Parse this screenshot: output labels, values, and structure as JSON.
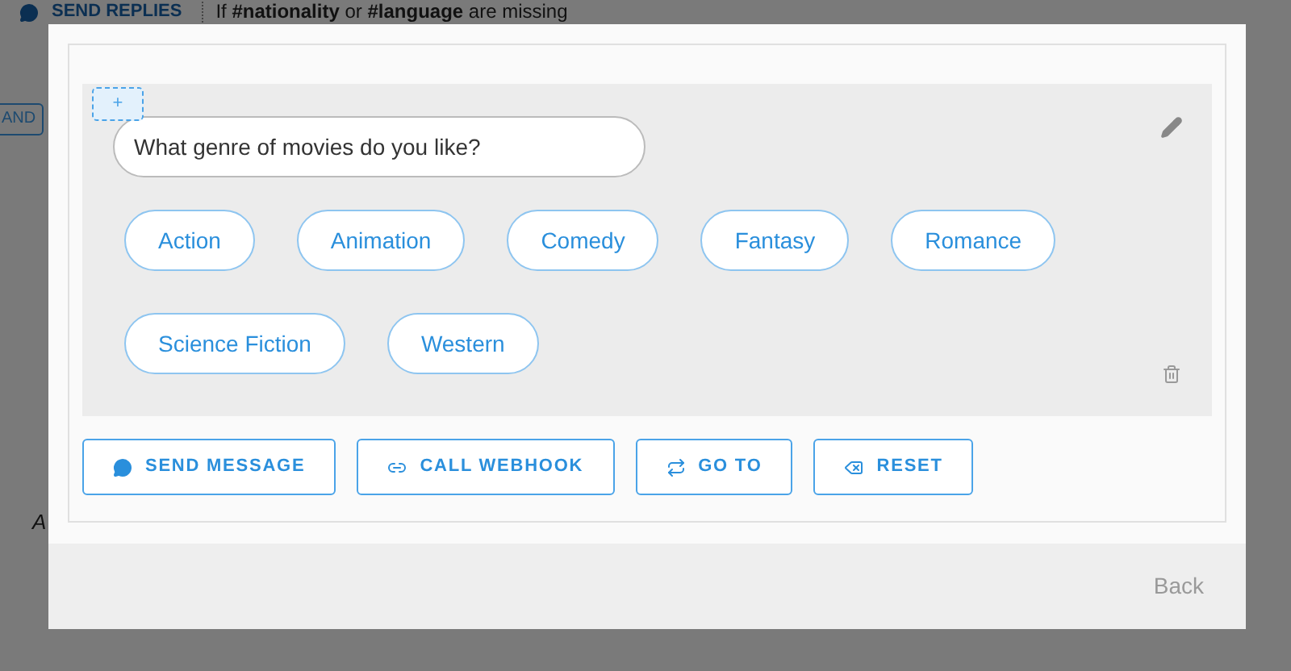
{
  "background": {
    "section_title": "SEND REPLIES",
    "condition": "If **#nationality** or **#language** are missing",
    "operator": "AND",
    "label": "A"
  },
  "dialog": {
    "add_button": "+",
    "question": {
      "value": "What genre of movies do you like?"
    },
    "quick_replies": [
      {
        "label": "Action"
      },
      {
        "label": "Animation"
      },
      {
        "label": "Comedy"
      },
      {
        "label": "Fantasy"
      },
      {
        "label": "Romance"
      },
      {
        "label": "Science Fiction"
      },
      {
        "label": "Western"
      }
    ],
    "actions": [
      {
        "kind": "message",
        "label": "SEND MESSAGE"
      },
      {
        "kind": "webhook",
        "label": "CALL WEBHOOK"
      },
      {
        "kind": "goto",
        "label": "GO TO"
      },
      {
        "kind": "reset",
        "label": "RESET"
      }
    ],
    "footer_button": "Back"
  }
}
